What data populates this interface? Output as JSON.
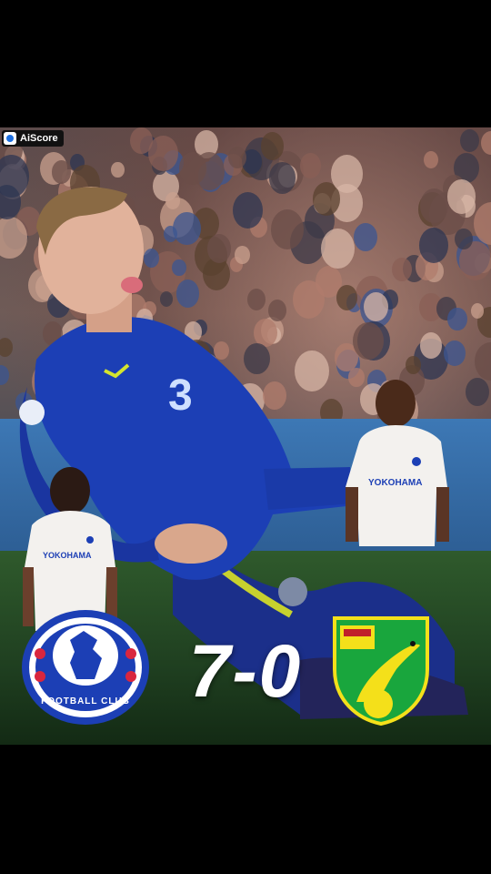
{
  "watermark": {
    "label": "AiScore",
    "icon": "aiscore-logo-icon"
  },
  "match": {
    "home_team": "Chelsea",
    "away_team": "Norwich City",
    "score": "7-0"
  },
  "home_crest": {
    "text": "FOOTBALL CLUB",
    "icon": "chelsea-lion-crest-icon"
  },
  "away_crest": {
    "icon": "norwich-canary-crest-icon"
  },
  "sponsor": "YOKOHAMA TYRES",
  "colors": {
    "chelsea_blue": "#1c3fb5",
    "norwich_yellow": "#f4e01a",
    "norwich_green": "#19a63d",
    "away_kit": "#f3f1ee"
  }
}
